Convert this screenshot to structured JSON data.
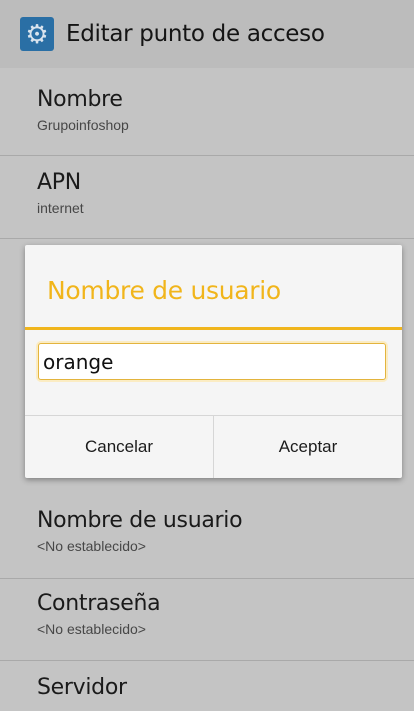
{
  "actionbar": {
    "title": "Editar punto de acceso",
    "icon": "settings-gear-icon"
  },
  "prefs": [
    {
      "label": "Nombre",
      "value": "Grupoinfoshop"
    },
    {
      "label": "APN",
      "value": "internet"
    },
    {
      "label": "Nombre de usuario",
      "value": "<No establecido>"
    },
    {
      "label": "Contraseña",
      "value": "<No establecido>"
    },
    {
      "label": "Servidor",
      "value": ""
    }
  ],
  "dialog": {
    "title": "Nombre de usuario",
    "input_value": "orange",
    "cancel_label": "Cancelar",
    "ok_label": "Aceptar"
  },
  "colors": {
    "accent": "#f1b51b",
    "actionbar_icon": "#2a6fa5"
  }
}
